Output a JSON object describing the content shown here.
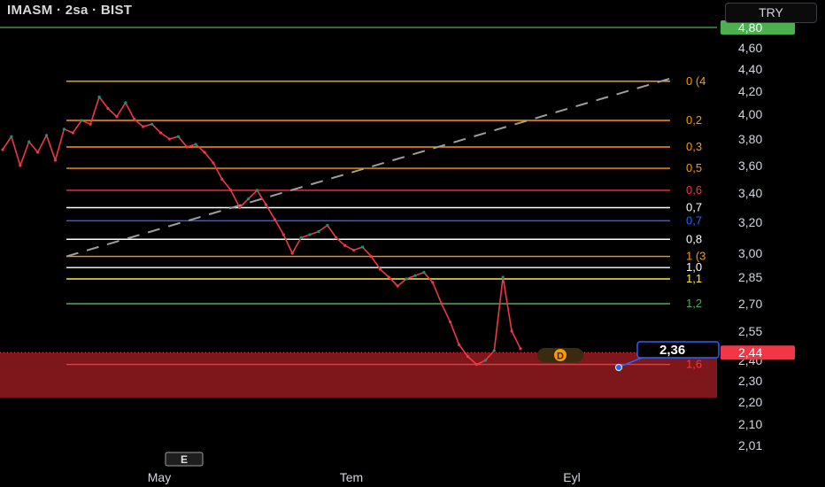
{
  "header": {
    "title": "IMASM · 2sa · BIST"
  },
  "currency": {
    "label": "TRY"
  },
  "price_axis": {
    "ticks": [
      "4,60",
      "4,40",
      "4,20",
      "4,00",
      "3,80",
      "3,60",
      "3,40",
      "3,20",
      "3,00",
      "2,85",
      "2,70",
      "2,55",
      "2,40",
      "2,30",
      "2,20",
      "2,10",
      "2,01"
    ],
    "top_badge": {
      "label": "4,80",
      "color": "#4caf50"
    },
    "last_badge": {
      "label": "2,44",
      "color": "#f23645"
    }
  },
  "time_axis": {
    "labels": [
      "May",
      "Tem",
      "Eyl"
    ]
  },
  "markers": {
    "earnings": "E",
    "dividend": "D"
  },
  "alert": {
    "label": "2,36"
  },
  "fib_levels": [
    {
      "label": "0 (4",
      "price": 4.29,
      "color": "#ff9800"
    },
    {
      "label": "0,2",
      "price": 3.95,
      "color": "#ff9800"
    },
    {
      "label": "0,3",
      "price": 3.74,
      "color": "#ff9800"
    },
    {
      "label": "0,5",
      "price": 3.58,
      "color": "#ff9800"
    },
    {
      "label": "0,6",
      "price": 3.42,
      "color": "#f23645"
    },
    {
      "label": "0,7",
      "price": 3.3,
      "color": "#ffffff"
    },
    {
      "label": "0,7",
      "price": 3.21,
      "color": "#2962ff"
    },
    {
      "label": "0,8",
      "price": 3.09,
      "color": "#ffffff"
    },
    {
      "label": "1 (3",
      "price": 2.98,
      "color": "#ff9800"
    },
    {
      "label": "1,0",
      "price": 2.91,
      "color": "#ffffff"
    },
    {
      "label": "1,1",
      "price": 2.84,
      "color": "#ffeb3b"
    },
    {
      "label": "1,2",
      "price": 2.7,
      "color": "#4caf50"
    },
    {
      "label": "1,6",
      "price": 2.38,
      "color": "#f23645"
    }
  ],
  "chart_data": {
    "type": "line",
    "title": "IMASM · 2sa · BIST",
    "x_labels": [
      "May",
      "Tem",
      "Eyl"
    ],
    "ylim": [
      2.01,
      4.8
    ],
    "y_ticks": [
      4.6,
      4.4,
      4.2,
      4.0,
      3.8,
      3.6,
      3.4,
      3.2,
      3.0,
      2.85,
      2.7,
      2.55,
      2.4,
      2.3,
      2.2,
      2.1,
      2.01
    ],
    "series": [
      {
        "values": [
          3.72,
          3.82,
          3.6,
          3.78,
          3.7,
          3.83,
          3.64,
          3.88,
          3.85,
          3.95,
          3.92,
          4.15,
          4.05,
          3.98,
          4.1,
          3.96,
          3.9,
          3.92,
          3.85,
          3.8,
          3.82,
          3.74,
          3.76,
          3.7,
          3.62,
          3.5,
          3.42,
          3.3,
          3.36,
          3.42,
          3.32,
          3.22,
          3.12,
          3.0,
          3.1,
          3.12,
          3.14,
          3.18,
          3.1,
          3.05,
          3.02,
          3.04,
          2.98,
          2.9,
          2.85,
          2.8,
          2.84,
          2.86,
          2.88,
          2.82,
          2.7,
          2.6,
          2.48,
          2.42,
          2.38,
          2.4,
          2.45,
          2.85,
          2.55,
          2.46
        ]
      }
    ],
    "reference_line": {
      "price": 4.8,
      "color": "#4caf50"
    },
    "zone": {
      "from": 2.22,
      "to": 2.44,
      "color": "#8b1a1f"
    },
    "last_price": 2.44,
    "trend_line": {
      "from_price": 2.98,
      "to_price": 4.29
    }
  }
}
